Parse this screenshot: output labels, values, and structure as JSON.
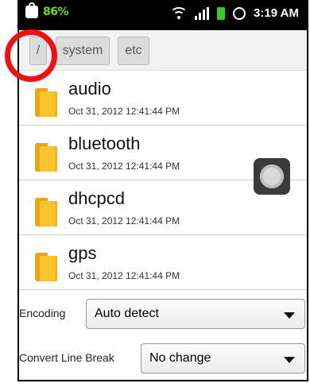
{
  "status": {
    "battery_percent": "86%",
    "time": "3:19 AM",
    "icons": [
      "shopping-bag-icon",
      "wifi-icon",
      "signal-icon",
      "battery-icon",
      "alarm-icon"
    ]
  },
  "breadcrumbs": [
    "/",
    "system",
    "etc"
  ],
  "files": [
    {
      "name": "audio",
      "date": "Oct 31, 2012 12:41:44 PM"
    },
    {
      "name": "bluetooth",
      "date": "Oct 31, 2012 12:41:44 PM"
    },
    {
      "name": "dhcpcd",
      "date": "Oct 31, 2012 12:41:44 PM"
    },
    {
      "name": "gps",
      "date": "Oct 31, 2012 12:41:44 PM"
    }
  ],
  "encoding": {
    "label": "Encoding",
    "value": "Auto detect"
  },
  "line_break": {
    "label": "Convert Line Break",
    "value": "No change"
  },
  "colors": {
    "highlight": "#ee1111",
    "folder": "#fbc32c",
    "battery_text": "#7ad90d"
  }
}
